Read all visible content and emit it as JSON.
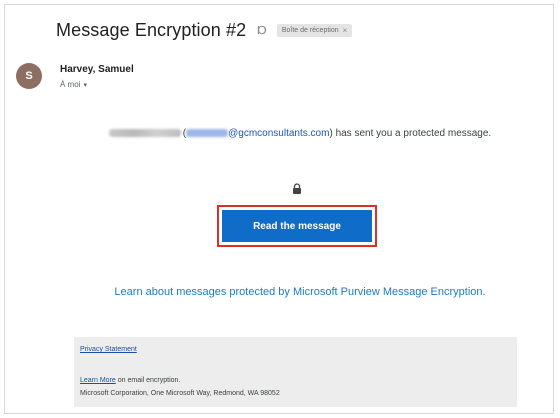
{
  "email": {
    "subject": "Message Encryption #2",
    "importance_icon": "importance-marker-icon",
    "label": "Boîte de réception",
    "label_close": "×",
    "avatar_letter": "S",
    "sender": "Harvey, Samuel",
    "recipient": "À moi",
    "recipient_caret": "▾"
  },
  "body": {
    "email_open": "(",
    "email_address": "@gcmconsultants.com",
    "email_close": ")",
    "message_tail": "has sent you a protected message.",
    "lock_icon": "lock-icon",
    "read_button": "Read the message",
    "learn_text": "Learn about messages protected by Microsoft Purview Message Encryption."
  },
  "footer": {
    "privacy": "Privacy Statement",
    "learn_more": "Learn More",
    "learn_more_tail": " on email encryption.",
    "address": "Microsoft Corporation, One Microsoft Way, Redmond, WA 98052"
  },
  "colors": {
    "button": "#0f6cc8",
    "button_outline": "#d9302c",
    "link": "#1b7cc0",
    "avatar": "#8d6e63"
  }
}
